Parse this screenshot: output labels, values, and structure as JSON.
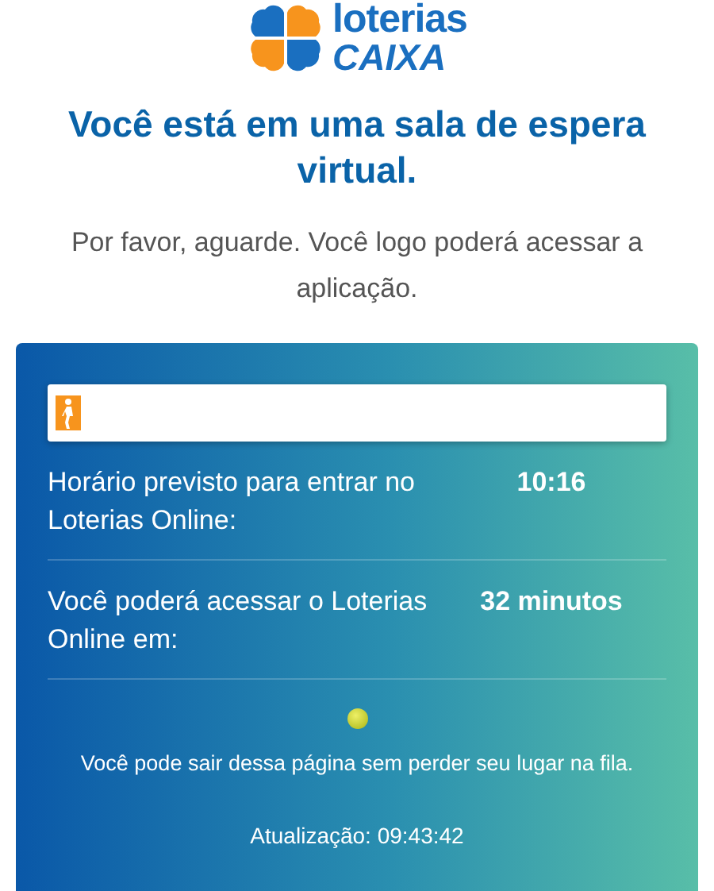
{
  "logo": {
    "line_1": "loterias",
    "line_2": "CAIXA"
  },
  "title": "Você está em uma sala de espera virtual.",
  "subtitle": "Por favor, aguarde. Você logo poderá acessar a aplicação.",
  "queue": {
    "progress": {
      "level": 0
    },
    "rows": [
      {
        "label": "Horário previsto para entrar no Loterias Online:",
        "value": "10:16"
      },
      {
        "label": "Você poderá acessar o Loterias Online em:",
        "value": "32 minutos"
      }
    ],
    "notice": "Você pode sair dessa página sem perder seu lugar na fila.",
    "updated": "Atualização: 09:43:42"
  }
}
